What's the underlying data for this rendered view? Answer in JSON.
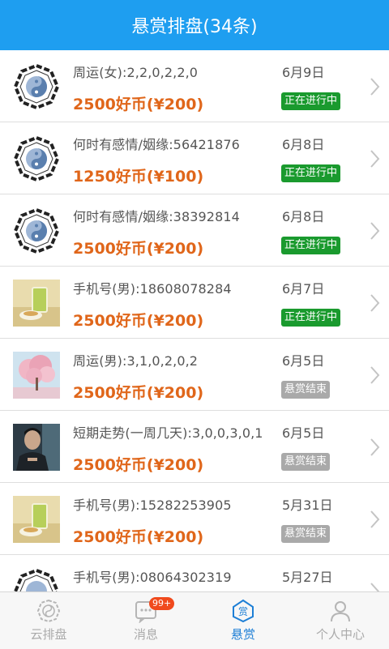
{
  "header": {
    "title": "悬赏排盘(34条)"
  },
  "items": [
    {
      "title": "周运(女):2,2,0,2,2,0",
      "reward": "2500好币(¥200)",
      "date": "6月9日",
      "status": "正在进行中",
      "status_type": "active",
      "thumb": "bagua-icon"
    },
    {
      "title": "何时有感情/姻缘:56421876",
      "reward": "1250好币(¥100)",
      "date": "6月8日",
      "status": "正在进行中",
      "status_type": "active",
      "thumb": "bagua-icon"
    },
    {
      "title": "何时有感情/姻缘:38392814",
      "reward": "2500好币(¥200)",
      "date": "6月8日",
      "status": "正在进行中",
      "status_type": "active",
      "thumb": "bagua-icon"
    },
    {
      "title": "手机号(男):18608078284",
      "reward": "2500好币(¥200)",
      "date": "6月7日",
      "status": "正在进行中",
      "status_type": "active",
      "thumb": "drink-photo"
    },
    {
      "title": "周运(男):3,1,0,2,0,2",
      "reward": "2500好币(¥200)",
      "date": "6月5日",
      "status": "悬赏结束",
      "status_type": "ended",
      "thumb": "blossom-tree-photo"
    },
    {
      "title": "短期走势(一周几天):3,0,0,3,0,1",
      "reward": "2500好币(¥200)",
      "date": "6月5日",
      "status": "悬赏结束",
      "status_type": "ended",
      "thumb": "man-portrait-photo"
    },
    {
      "title": "手机号(男):15282253905",
      "reward": "2500好币(¥200)",
      "date": "5月31日",
      "status": "悬赏结束",
      "status_type": "ended",
      "thumb": "drink-photo"
    },
    {
      "title": "手机号(男):08064302319",
      "reward": "",
      "date": "5月27日",
      "status": "",
      "status_type": "",
      "thumb": "bagua-icon"
    }
  ],
  "tabs": [
    {
      "label": "云排盘",
      "icon": "bagua-icon"
    },
    {
      "label": "消息",
      "icon": "message-icon",
      "badge": "99+"
    },
    {
      "label": "悬赏",
      "icon": "reward-icon"
    },
    {
      "label": "个人中心",
      "icon": "user-icon"
    }
  ],
  "colors": {
    "header": "#1e9ef0",
    "reward": "#e0661a",
    "active_badge": "#1a9a2e",
    "ended_badge": "#a9a9a9",
    "tab_selected": "#1e7fd6"
  }
}
